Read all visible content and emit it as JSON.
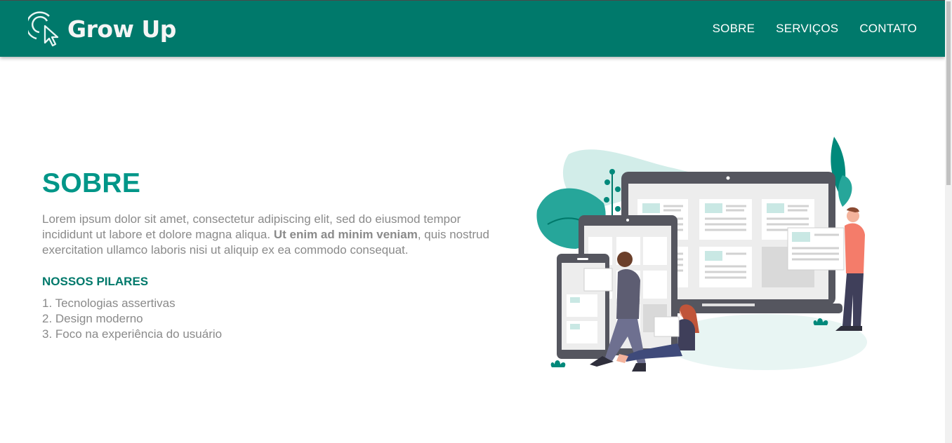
{
  "brand": {
    "name": "Grow Up",
    "logo_icon": "cursor-click-icon"
  },
  "nav": {
    "items": [
      "SOBRE",
      "SERVIÇOS",
      "CONTATO"
    ]
  },
  "about": {
    "title": "SOBRE",
    "text_part1": "Lorem ipsum dolor sit amet, consectetur adipiscing elit, sed do eiusmod tempor incididunt ut labore et dolore magna aliqua. ",
    "text_bold": "Ut enim ad minim veniam",
    "text_part2": ", quis nostrud exercitation ullamco laboris nisi ut aliquip ex ea commodo consequat.",
    "pillars_title": "NOSSOS PILARES",
    "pillars": [
      "1. Tecnologias assertivas",
      "2. Design moderno",
      "3. Foco na experiência do usuário"
    ]
  },
  "colors": {
    "primary": "#00796b",
    "accent": "#009688",
    "text": "#8a8a8a"
  }
}
